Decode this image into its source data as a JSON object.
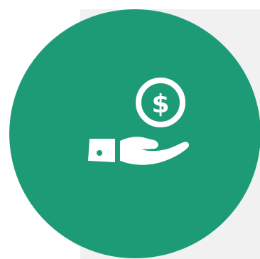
{
  "icon": {
    "name": "hand-holding-dollar-icon",
    "symbol": "$"
  },
  "colors": {
    "circle": "#1d9b77",
    "backdrop": "#f1f1f1",
    "icon": "#ffffff"
  }
}
